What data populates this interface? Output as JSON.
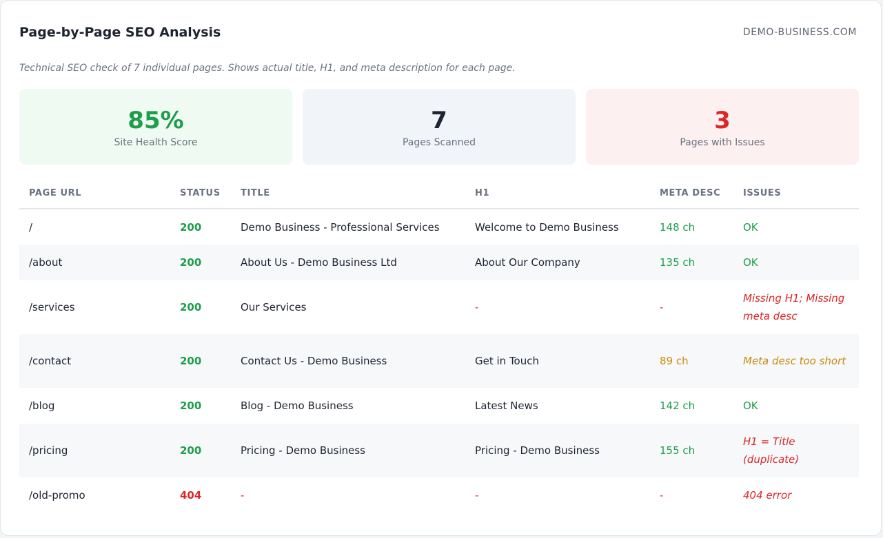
{
  "header": {
    "title": "Page-by-Page SEO Analysis",
    "domain": "DEMO-BUSINESS.COM"
  },
  "subtitle": "Technical SEO check of 7 individual pages. Shows actual title, H1, and meta description for each page.",
  "stats": [
    {
      "value": "85%",
      "label": "Site Health Score"
    },
    {
      "value": "7",
      "label": "Pages Scanned"
    },
    {
      "value": "3",
      "label": "Pages with Issues"
    }
  ],
  "table": {
    "headers": [
      "PAGE URL",
      "STATUS",
      "TITLE",
      "H1",
      "META DESC",
      "ISSUES"
    ],
    "rows": [
      {
        "url": "/",
        "status": "200",
        "title": "Demo Business - Professional Services",
        "h1": "Welcome to Demo Business",
        "meta": "148 ch",
        "issues": "OK"
      },
      {
        "url": "/about",
        "status": "200",
        "title": "About Us - Demo Business Ltd",
        "h1": "About Our Company",
        "meta": "135 ch",
        "issues": "OK"
      },
      {
        "url": "/services",
        "status": "200",
        "title": "Our Services",
        "h1": "-",
        "meta": "-",
        "issues": "Missing H1; Missing meta desc"
      },
      {
        "url": "/contact",
        "status": "200",
        "title": "Contact Us - Demo Business",
        "h1": "Get in Touch",
        "meta": "89 ch",
        "issues": "Meta desc too short"
      },
      {
        "url": "/blog",
        "status": "200",
        "title": "Blog - Demo Business",
        "h1": "Latest News",
        "meta": "142 ch",
        "issues": "OK"
      },
      {
        "url": "/pricing",
        "status": "200",
        "title": "Pricing - Demo Business",
        "h1": "Pricing - Demo Business",
        "meta": "155 ch",
        "issues": "H1 = Title (duplicate)"
      },
      {
        "url": "/old-promo",
        "status": "404",
        "title": "-",
        "h1": "-",
        "meta": "-",
        "issues": "404 error"
      }
    ]
  },
  "colors": {
    "good": "#1e9d4b",
    "warn": "#c98a0e",
    "bad": "#dc2626"
  }
}
